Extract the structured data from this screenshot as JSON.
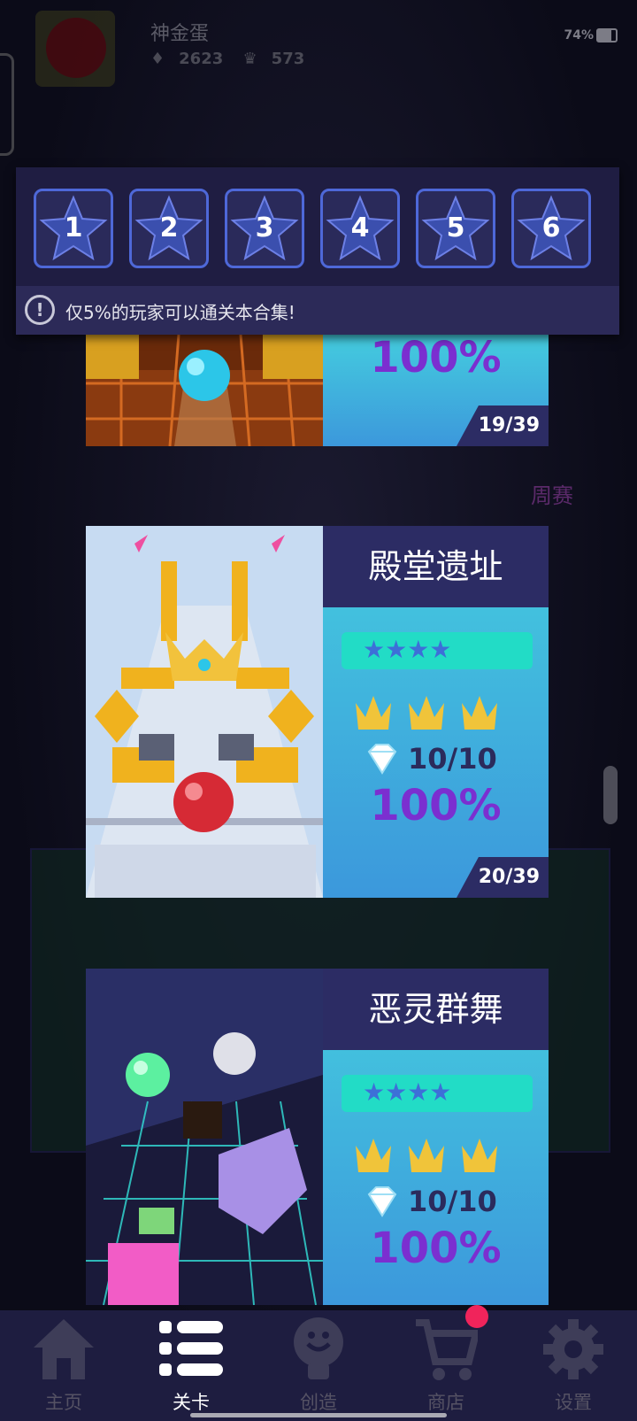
{
  "header": {
    "user_name": "神金蛋",
    "gems": "2623",
    "crowns": "573",
    "battery": "74%"
  },
  "background": {
    "dim_label": "周赛"
  },
  "star_levels": [
    "1",
    "2",
    "3",
    "4",
    "5",
    "6"
  ],
  "notice": {
    "text": "仅5%的玩家可以通关本合集!"
  },
  "cards": [
    {
      "title": "",
      "percent": "100%",
      "counter": "19/39"
    },
    {
      "title": "殿堂遗址",
      "stars": "★★★★",
      "gems": "10/10",
      "percent": "100%",
      "counter": "20/39"
    },
    {
      "title": "恶灵群舞",
      "stars": "★★★★",
      "gems": "10/10",
      "percent": "100%",
      "counter": ""
    }
  ],
  "nav": [
    {
      "label": "主页",
      "icon": "home-icon"
    },
    {
      "label": "关卡",
      "icon": "list-icon"
    },
    {
      "label": "创造",
      "icon": "lightbulb-icon"
    },
    {
      "label": "商店",
      "icon": "cart-icon"
    },
    {
      "label": "设置",
      "icon": "gear-icon"
    }
  ],
  "colors": {
    "accent_blue": "#4e68d8",
    "panel": "#1f1d42",
    "card_title": "#2c2c64",
    "percent": "#7b2fd0",
    "crown": "#f0c43a",
    "badge": "#f0245b"
  }
}
